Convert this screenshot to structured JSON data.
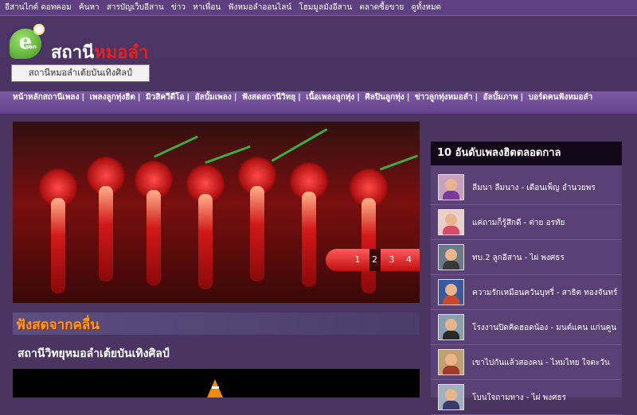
{
  "topbar": {
    "links": [
      "อีสานไกด์ ดอทคอม",
      "ค้นหา",
      "สารบัญเว็บอีสาน",
      "ข่าว",
      "หาเพื่อน",
      "ฟังหมอลำออนไลน์",
      "โฮมมูลมังอีสาน",
      "ตลาดซื้อขาย",
      "ดูทั้งหมด"
    ]
  },
  "header": {
    "logo_letter": "e",
    "logo_small": "san",
    "title_part1": "สถานี",
    "title_part2": "หมอลำ",
    "tagline": "สถานีหมอลำเต้ยบันเทิงศิลป์"
  },
  "nav": {
    "items": [
      "หน้าหลักสถานีเพลง",
      "เพลงลูกทุ่งฮิต",
      "มิวสิควีดีโอ",
      "อัลบั้มเพลง",
      "ฟังสดสถานีวิทยุ",
      "เนื้อเพลงลูกทุ่ง",
      "ศิลปินลูกทุ่ง",
      "ข่าวลูกทุ่งหมอลำ",
      "อัลบั้มภาพ",
      "บอร์ดคนฟังหมอลำ"
    ]
  },
  "slider": {
    "pages": [
      "1",
      "2",
      "3",
      "4"
    ],
    "active_page": "2"
  },
  "live": {
    "banner": "ฟังสดจากคลื่น",
    "station": "สถานีวิทยุหมอลำเต้ยบันเทิงศิลป์"
  },
  "sidebar": {
    "title": "10 อันดับเพลงฮิตตลอดกาล",
    "songs": [
      "ลืมนา ลืมนาง - เดือนเพ็ญ อำนวยพร",
      "แค่ถามก็รู้สึกดี - ต่าย อรทัย",
      "ทบ.2 ลูกอีสาน - ไผ่ พงศธร",
      "ความรักเหมือนควันบุหรี่ - สาธิต ทองจันทร์",
      "โรงงานปิดคิดฮอดน้อง - มนต์แคน แก่นคูน",
      "เขาไปกันแล้วสองคน - ไหมไทย ใจตะวัน",
      "โบนใจถามทาง - ไผ่ พงศธร"
    ]
  },
  "colors": {
    "background": "#4a3560",
    "nav": "#6f4c98",
    "accent_red": "#e62020",
    "banner_orange": "#ff9a1a"
  }
}
